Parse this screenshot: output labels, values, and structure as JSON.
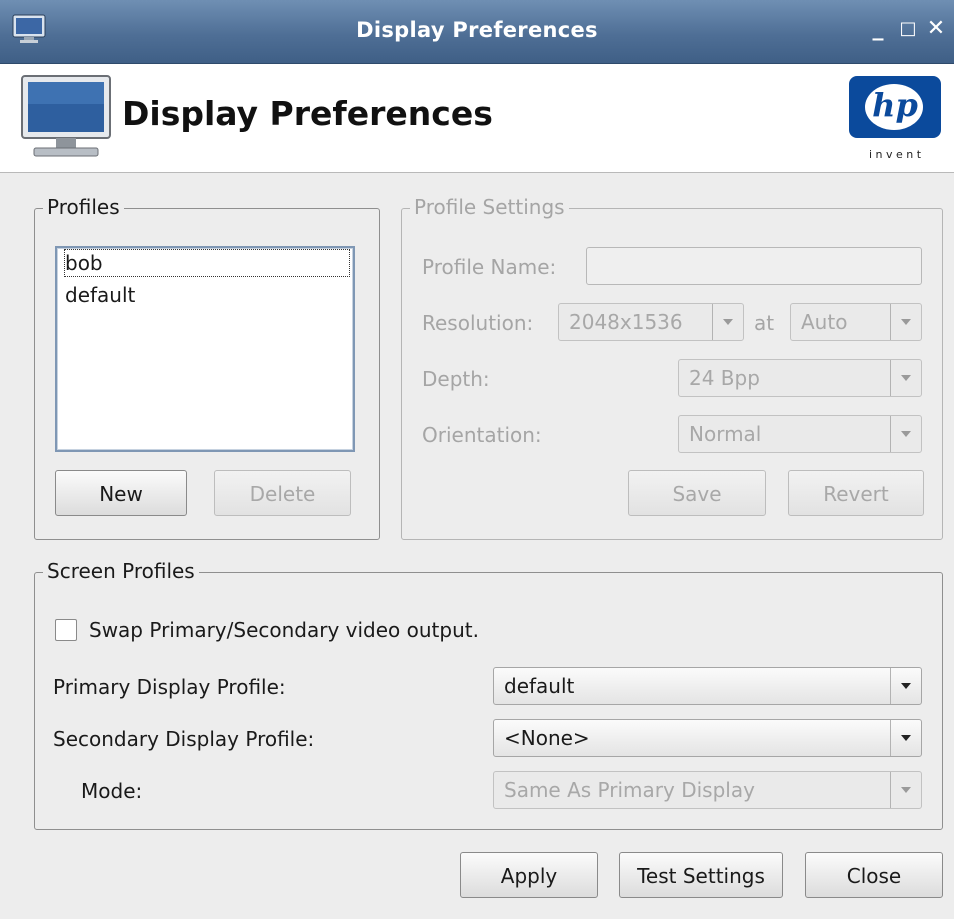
{
  "window": {
    "title": "Display Preferences",
    "controls": {
      "minimize": "_",
      "maximize": "□",
      "close": "✕"
    }
  },
  "header": {
    "title": "Display Preferences",
    "logo_text": "hp",
    "logo_tagline": "i n v e n t"
  },
  "profiles": {
    "group_label": "Profiles",
    "items": [
      "bob",
      "default"
    ],
    "new_button": "New",
    "delete_button": "Delete"
  },
  "profile_settings": {
    "group_label": "Profile Settings",
    "name_label": "Profile Name:",
    "name_value": "",
    "resolution_label": "Resolution:",
    "resolution_value": "2048x1536",
    "at_label": "at",
    "refresh_value": "Auto",
    "depth_label": "Depth:",
    "depth_value": "24 Bpp",
    "orientation_label": "Orientation:",
    "orientation_value": "Normal",
    "save_button": "Save",
    "revert_button": "Revert"
  },
  "screen_profiles": {
    "group_label": "Screen Profiles",
    "swap_label": "Swap Primary/Secondary video output.",
    "swap_checked": false,
    "primary_label": "Primary Display Profile:",
    "primary_value": "default",
    "secondary_label": "Secondary Display Profile:",
    "secondary_value": "<None>",
    "mode_label": "Mode:",
    "mode_value": "Same As Primary Display"
  },
  "footer": {
    "apply_button": "Apply",
    "test_button": "Test Settings",
    "close_button": "Close"
  },
  "colors": {
    "titlebar": "#4f6f96",
    "hp_blue": "#0b4a9c"
  }
}
